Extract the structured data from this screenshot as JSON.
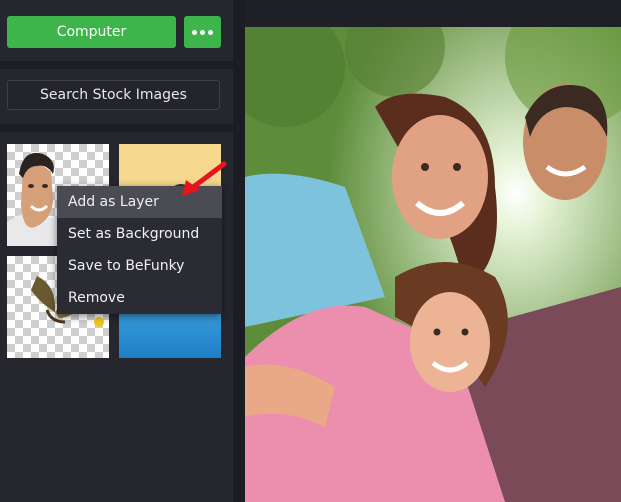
{
  "sidebar": {
    "computer_label": "Computer",
    "search_stock_label": "Search Stock Images"
  },
  "context_menu": {
    "items": [
      {
        "label": "Add as Layer",
        "active": true
      },
      {
        "label": "Set as Background",
        "active": false
      },
      {
        "label": "Save to BeFunky",
        "active": false
      },
      {
        "label": "Remove",
        "active": false
      }
    ]
  },
  "colors": {
    "accent_green": "#3db54a",
    "annotation_arrow": "#e8141b",
    "sidebar_bg": "#26272e"
  },
  "icons": {
    "more": "more-options-icon",
    "arrow": "red-arrow-annotation"
  }
}
